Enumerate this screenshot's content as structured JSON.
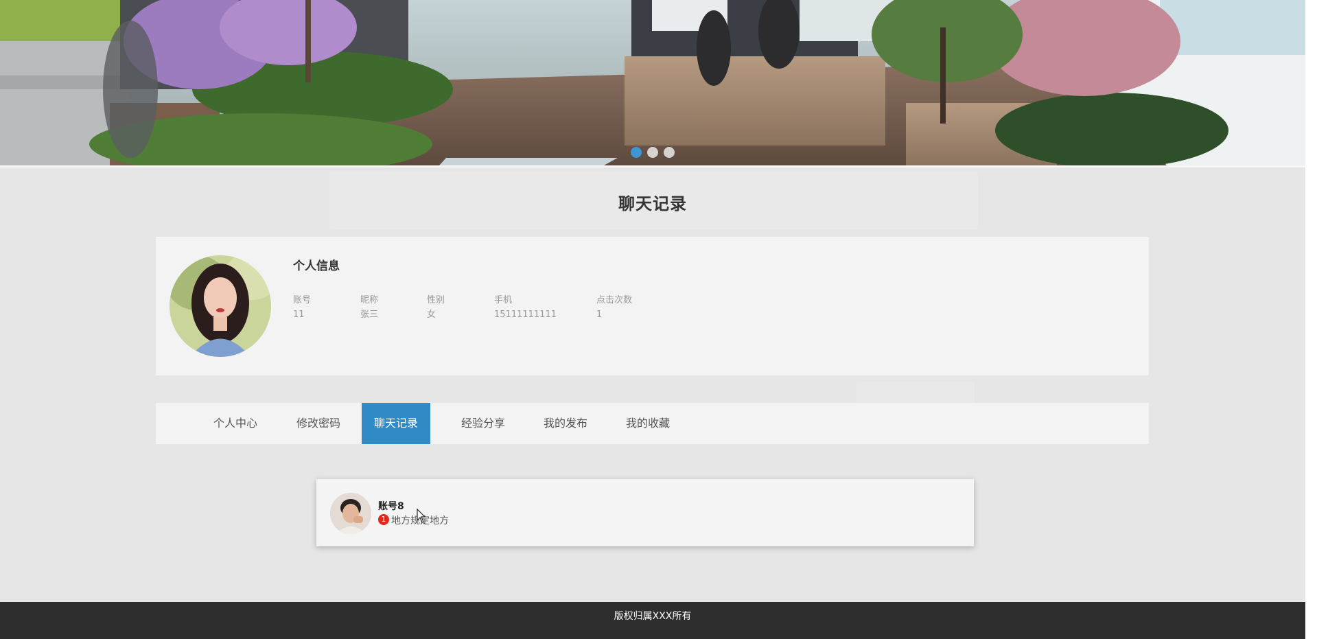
{
  "banner": {
    "carousel": {
      "slide_count": 3,
      "active_index": 0,
      "active_color": "#3e96d4"
    }
  },
  "page": {
    "title": "聊天记录"
  },
  "profile": {
    "heading": "个人信息",
    "fields": [
      {
        "label": "账号",
        "value": "11"
      },
      {
        "label": "昵称",
        "value": "张三"
      },
      {
        "label": "性别",
        "value": "女"
      },
      {
        "label": "手机",
        "value": "15111111111"
      },
      {
        "label": "点击次数",
        "value": "1"
      }
    ]
  },
  "tabs": {
    "items": [
      {
        "label": "个人中心"
      },
      {
        "label": "修改密码"
      },
      {
        "label": "聊天记录"
      },
      {
        "label": "经验分享"
      },
      {
        "label": "我的发布"
      },
      {
        "label": "我的收藏"
      }
    ],
    "active_index": 2,
    "active_color": "#2f8ac6"
  },
  "chats": [
    {
      "name": "账号8",
      "unread": "1",
      "message": "地方规定地方"
    }
  ],
  "footer": {
    "text": "版权归属XXX所有"
  }
}
